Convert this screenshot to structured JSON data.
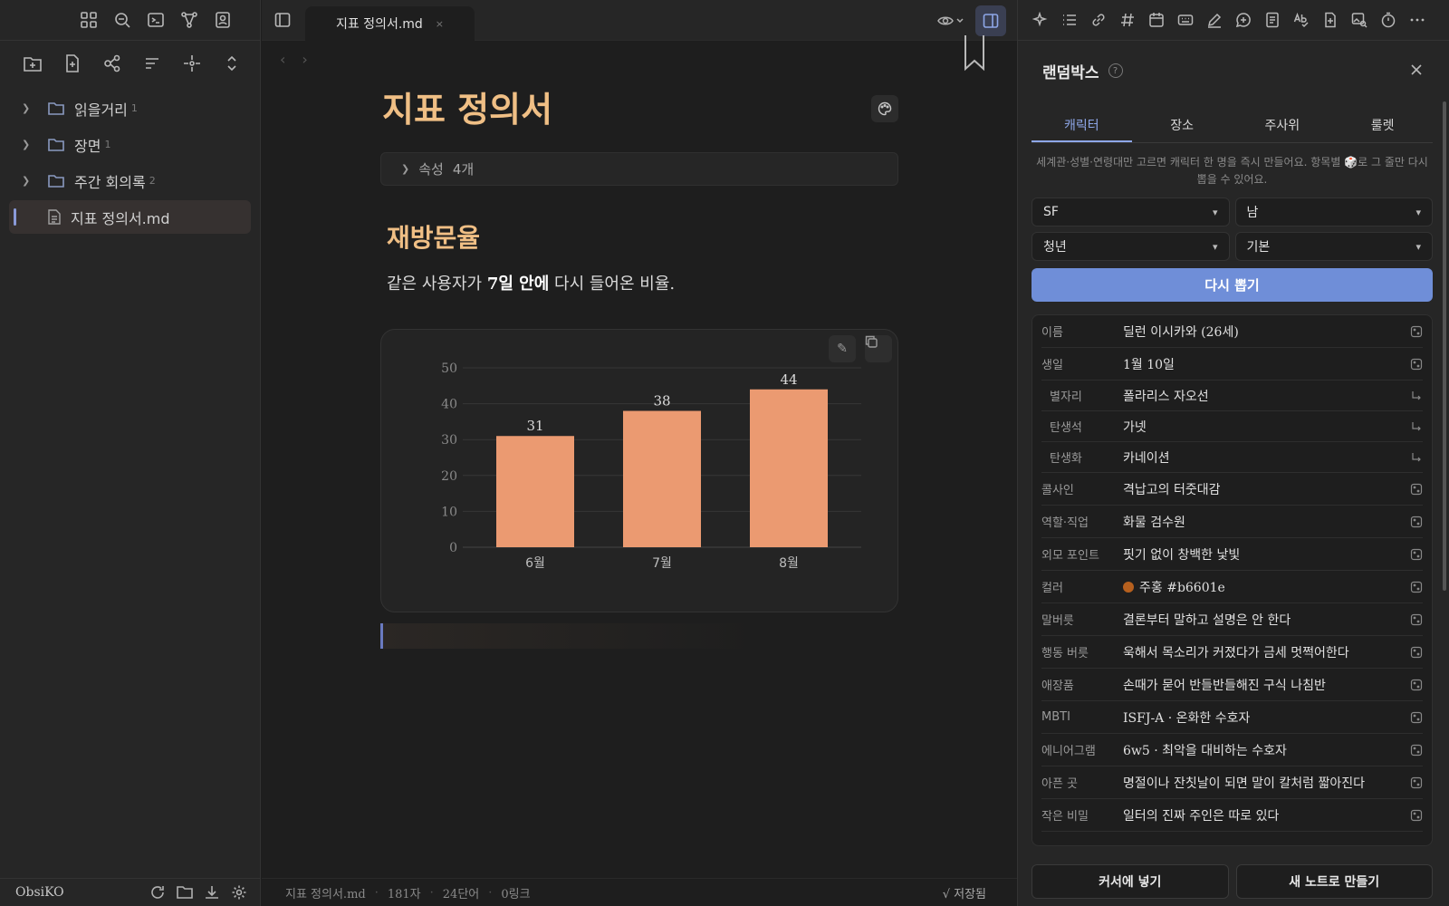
{
  "left_sidebar": {
    "folders": [
      {
        "label": "읽을거리",
        "count": "1"
      },
      {
        "label": "장면",
        "count": "1"
      },
      {
        "label": "주간 회의록",
        "count": "2"
      }
    ],
    "active_file": "지표 정의서.md",
    "vault_name": "ObsiKO"
  },
  "tab": {
    "title": "지표 정의서.md",
    "close": "×"
  },
  "doc": {
    "title": "지표 정의서",
    "properties_label": "속성",
    "properties_count": "4개",
    "heading": "재방문율",
    "para_before": "같은 사용자가 ",
    "para_bold": "7일 안에",
    "para_after": " 다시 들어온 비율."
  },
  "chart_data": {
    "type": "bar",
    "categories": [
      "6월",
      "7월",
      "8월"
    ],
    "values": [
      31,
      38,
      44
    ],
    "ylim": [
      0,
      50
    ],
    "yticks": [
      0,
      10,
      20,
      30,
      40,
      50
    ],
    "bar_color": "#eb9a71",
    "title": "",
    "xlabel": "",
    "ylabel": ""
  },
  "status": {
    "file": "지표 정의서.md",
    "chars": "181자",
    "words": "24단어",
    "links": "0링크",
    "saved": "√ 저장됨"
  },
  "right_panel": {
    "title": "랜덤박스",
    "help": "?",
    "tabs": [
      "캐릭터",
      "장소",
      "주사위",
      "룰렛"
    ],
    "active_tab": "캐릭터",
    "description": "세계관·성별·연령대만 고르면 캐릭터 한 명을 즉시 만들어요. 항목별 🎲로 그 줄만 다시 뽑을 수 있어요.",
    "selects": [
      "SF",
      "남",
      "청년",
      "기본"
    ],
    "redraw_label": "다시 뽑기",
    "rows": [
      {
        "k": "이름",
        "v": "딜런 이시카와 (26세)"
      },
      {
        "k": "생일",
        "v": "1월 10일"
      },
      {
        "k": "별자리",
        "v": "폴라리스 자오선",
        "sub": true
      },
      {
        "k": "탄생석",
        "v": "가넷",
        "sub": true
      },
      {
        "k": "탄생화",
        "v": "카네이션",
        "sub": true
      },
      {
        "k": "콜사인",
        "v": "격납고의 터줏대감"
      },
      {
        "k": "역할·직업",
        "v": "화물 검수원"
      },
      {
        "k": "외모 포인트",
        "v": "핏기 없이 창백한 낯빛"
      },
      {
        "k": "컬러",
        "v": "주홍 #b6601e",
        "color": "#b6601e"
      },
      {
        "k": "말버릇",
        "v": "결론부터 말하고 설명은 안 한다"
      },
      {
        "k": "행동 버릇",
        "v": "욱해서 목소리가 커졌다가 금세 멋쩍어한다"
      },
      {
        "k": "애장품",
        "v": "손때가 묻어 반들반들해진 구식 나침반"
      },
      {
        "k": "MBTI",
        "v": "ISFJ-A · 온화한 수호자"
      },
      {
        "k": "에니어그램",
        "v": "6w5 · 최악을 대비하는 수호자"
      },
      {
        "k": "아픈 곳",
        "v": "명절이나 잔칫날이 되면 말이 칼처럼 짧아진다"
      },
      {
        "k": "작은 비밀",
        "v": "일터의 진짜 주인은 따로 있다"
      }
    ],
    "insert_label": "커서에 넣기",
    "new_note_label": "새 노트로 만들기"
  }
}
